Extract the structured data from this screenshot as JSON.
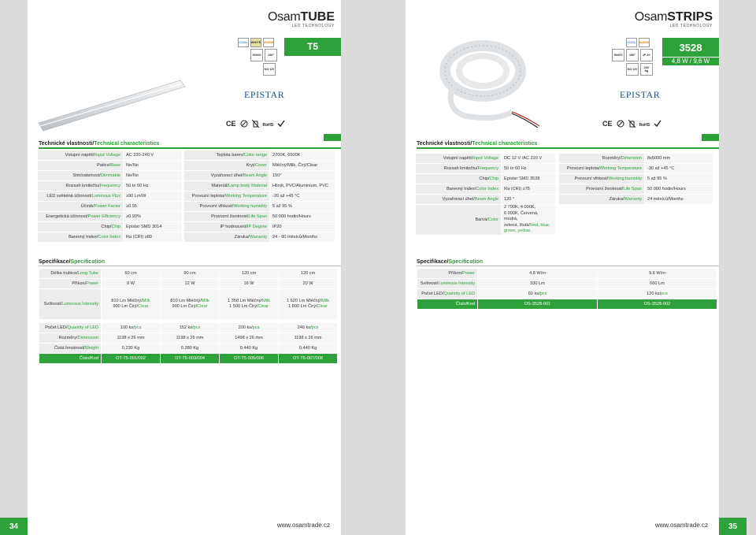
{
  "left": {
    "brand": {
      "w1": "Osam",
      "w2": "TUBE",
      "sub": "LED TECHNOLOGY"
    },
    "badges": {
      "cool": "COOL",
      "white": "WHITE",
      "warm": "WARM",
      "hours": "50000",
      "angle": "150°",
      "nouv": "NO UV"
    },
    "product": "T5",
    "chip_brand": "EPISTAR",
    "certs": [
      "CE",
      "RoHS"
    ],
    "tech_title": "Technické vlastnosti/",
    "tech_title_en": "Technical characteristics",
    "tech_col1": [
      {
        "cz": "Vstupní napětí/",
        "en": "Input Voltage",
        "v": "AC 220-240 V"
      },
      {
        "cz": "Patice/",
        "en": "Base",
        "v": "Ne/No"
      },
      {
        "cz": "Stmívatelnost/",
        "en": "Dimmable",
        "v": "Ne/No"
      },
      {
        "cz": "Rozsah kmitočtu/",
        "en": "Frequency",
        "v": "50 to 60 Hz"
      },
      {
        "cz": "LED světelná účinnost/",
        "en": "Luminous Flux",
        "v": "≥90 Lm/W"
      },
      {
        "cz": "Účiník/",
        "en": "Power Factor",
        "v": "≥0.95"
      },
      {
        "cz": "Energetická účinnost/",
        "en": "Power Efficiency",
        "v": "≥0.90%"
      },
      {
        "cz": "Chip/",
        "en": "Chip",
        "v": "Epistar SMD 3014"
      },
      {
        "cz": "Barevný Index/",
        "en": "Color Index",
        "v": "Ra (CRI) ≥80"
      }
    ],
    "tech_col2": [
      {
        "cz": "Teplota barev/",
        "en": "Color range",
        "v": "2700K, 6500K"
      },
      {
        "cz": "Kryt/",
        "en": "Cover",
        "v": "Mléčný/Milk, Čirý/Clear"
      },
      {
        "cz": "Vyzařovací úhel/",
        "en": "Beam Angle",
        "v": "150°"
      },
      {
        "cz": "Materiál/",
        "en": "Lamp body Material",
        "v": "Hliník, PVC/Aluminium, PVC"
      },
      {
        "cz": "Provozní teplota/",
        "en": "Working Temperature",
        "v": "-20 až +45 °C"
      },
      {
        "cz": "Provozní vlhkost/",
        "en": "Working humidity",
        "v": "5 až 95 %"
      },
      {
        "cz": "Provozní životnost/",
        "en": "Life Span",
        "v": "50 000 hodin/Hours"
      },
      {
        "cz": "IP hodnocení/",
        "en": "IP Degree",
        "v": "IP20"
      },
      {
        "cz": "Záruka/",
        "en": "Warranty",
        "v": "24 - 60 měsíců/Months"
      }
    ],
    "spec_title": "Specifikace/",
    "spec_title_en": "Specification",
    "spec": {
      "length": {
        "cz": "Délka trubice/",
        "en": "Long Tube",
        "vals": [
          "60 cm",
          "90 cm",
          "120 cm",
          "120 cm"
        ]
      },
      "power": {
        "cz": "Příkon/",
        "en": "Power",
        "vals": [
          "8 W",
          "12 W",
          "16 W",
          "20 W"
        ]
      },
      "lum": {
        "cz": "Svítivost/",
        "en": "Luminous Intensity",
        "vals": [
          {
            "a": "810 Lm Mléčný/",
            "ag": "Milk",
            "b": "900 Lm Čirý/",
            "bg": "Clear"
          },
          {
            "a": "810 Lm Mléčný/",
            "ag": "Milk",
            "b": "900 Lm Čirý/",
            "bg": "Clear"
          },
          {
            "a": "1 350 Lm Mléčný/",
            "ag": "Milk",
            "b": "1 500 Lm Čirý/",
            "bg": "Clear"
          },
          {
            "a": "1 620 Lm Mléčný/",
            "ag": "Milk",
            "b": "1 800 Lm Čirý/",
            "bg": "Clear"
          }
        ]
      },
      "qty": {
        "cz": "Počet LED/",
        "en": "Quantity of LED",
        "vals": [
          {
            "n": "100 ks/",
            "g": "pcs"
          },
          {
            "n": "152 ks/",
            "g": "pcs"
          },
          {
            "n": "200 ks/",
            "g": "pcs"
          },
          {
            "n": "240 ks/",
            "g": "pcs"
          }
        ]
      },
      "dim": {
        "cz": "Rozměry/",
        "en": "Dimension",
        "vals": [
          "1198 x 26 mm",
          "1198 x 26 mm",
          "1498 x 26 mm",
          "1198 x 26 mm"
        ]
      },
      "weight": {
        "cz": "Čistá hmotnost/",
        "en": "Weight",
        "vals": [
          "0,230 Kg",
          "0,380 Kg",
          "0,440 Kg",
          "0,440 Kg"
        ]
      },
      "code": {
        "label": "Číslo/Kod",
        "vals": [
          "OT-T5-001/002",
          "OT-T5-003/004",
          "OT-T5-005/006",
          "OT-T5-007/008"
        ]
      }
    },
    "footer": "www.osamtrade.cz",
    "page_number": "34"
  },
  "right": {
    "brand": {
      "w1": "Osam",
      "w2": "STRIPS",
      "sub": "LED TECHNOLOGY"
    },
    "badges": {
      "cool": "COOL",
      "warm": "WARM",
      "hours": "50000",
      "angle": "150°",
      "ip": "IP 20",
      "nouv": "NO UV",
      "voltage": "24V",
      "kg": "kg"
    },
    "product": "3528",
    "product_sub": "4,8 W / 9,6 W",
    "chip_brand": "EPISTAR",
    "certs": [
      "CE",
      "RoHS"
    ],
    "tech_title": "Technické vlastnosti/",
    "tech_title_en": "Technical characteristics",
    "tech_col1": [
      {
        "cz": "Vstupní napětí/",
        "en": "Input Voltage",
        "v": "DC 12 V /AC 220 V"
      },
      {
        "cz": "Rozsah kmitočtu/",
        "en": "Frequency",
        "v": "50 to 60 Hz"
      },
      {
        "cz": "Chip/",
        "en": "Chip",
        "v": "Epistar SMD 3528"
      },
      {
        "cz": "Barevný Index/",
        "en": "Color Index",
        "v": "Ra (CRI) ≥75"
      },
      {
        "cz": "Vyzařovací úhel/",
        "en": "Beam Angle",
        "v": "120 °"
      }
    ],
    "color_row": {
      "cz": "Barvá/",
      "en": "Color",
      "l1": "2 700K, 4 000K,",
      "l2": "6 000K, Červená, modrá,",
      "l3": "zelená, žlutá/",
      "l3g": "Red, blue,",
      "l4g": "green, yellow."
    },
    "tech_col2": [
      {
        "cz": "Rozměry/",
        "en": "Dimension",
        "v": "8x5000 mm"
      },
      {
        "cz": "Provozní teplota/",
        "en": "Working Temperature",
        "v": "-30 až +45 °C"
      },
      {
        "cz": "Provozní vlhkost/",
        "en": "Working humidity",
        "v": "5 až 95 %"
      },
      {
        "cz": "Provozní životnost/",
        "en": "Life Span",
        "v": "50 000 hodin/Hours"
      },
      {
        "cz": "Záruka/",
        "en": "Warranty",
        "v": "24 měsíců/Months"
      }
    ],
    "spec_title": "Specifikace/",
    "spec_title_en": "Specification",
    "spec": {
      "power": {
        "cz": "Příkon/",
        "en": "Power",
        "vals": [
          "4,8 W/m",
          "9,6 W/m"
        ]
      },
      "lum": {
        "cz": "Svítivost/",
        "en": "Luminous Intensity",
        "vals": [
          "330 Lm",
          "660 Lm"
        ]
      },
      "qty": {
        "cz": "Počet LED/",
        "en": "Quantity of LED",
        "vals": [
          {
            "n": "60 ks/",
            "g": "pcs"
          },
          {
            "n": "120 ks/",
            "g": "pcs"
          }
        ]
      },
      "code": {
        "label": "Číslo/Kod",
        "vals": [
          "OS-3528-001",
          "OS-3528-002"
        ]
      }
    },
    "footer": "www.osamtrade.cz",
    "page_number": "35"
  }
}
